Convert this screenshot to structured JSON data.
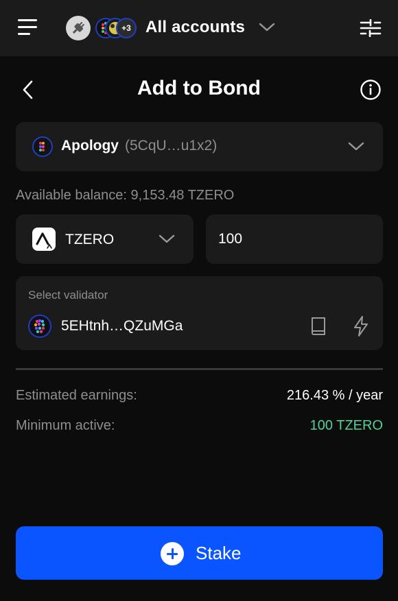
{
  "header": {
    "account_selector_title": "All accounts",
    "extra_accounts_badge": "+3",
    "page_title": "Add to Bond"
  },
  "account": {
    "name": "Apology",
    "address": "(5CqU…u1x2)"
  },
  "balance_text": "Available balance: 9,153.48 TZERO",
  "token": {
    "symbol": "TZERO"
  },
  "amount": {
    "value": "100"
  },
  "validator": {
    "label": "Select validator",
    "address": "5EHtnh…QZuMGa"
  },
  "summary": {
    "earnings_label": "Estimated earnings:",
    "earnings_value": "216.43 % / year",
    "min_active_label": "Minimum active:",
    "min_active_value": "100 TZERO"
  },
  "actions": {
    "stake_label": "Stake"
  },
  "colors": {
    "accent": "#0a55ff",
    "positive": "#4fd39a",
    "surface": "#1b1b1b",
    "background": "#0c0c0c"
  },
  "icons": [
    "menu-icon",
    "plug-icon",
    "chevron-down-icon",
    "sliders-icon",
    "chevron-left-icon",
    "info-icon",
    "book-icon",
    "lightning-icon",
    "plus-circle-icon"
  ]
}
